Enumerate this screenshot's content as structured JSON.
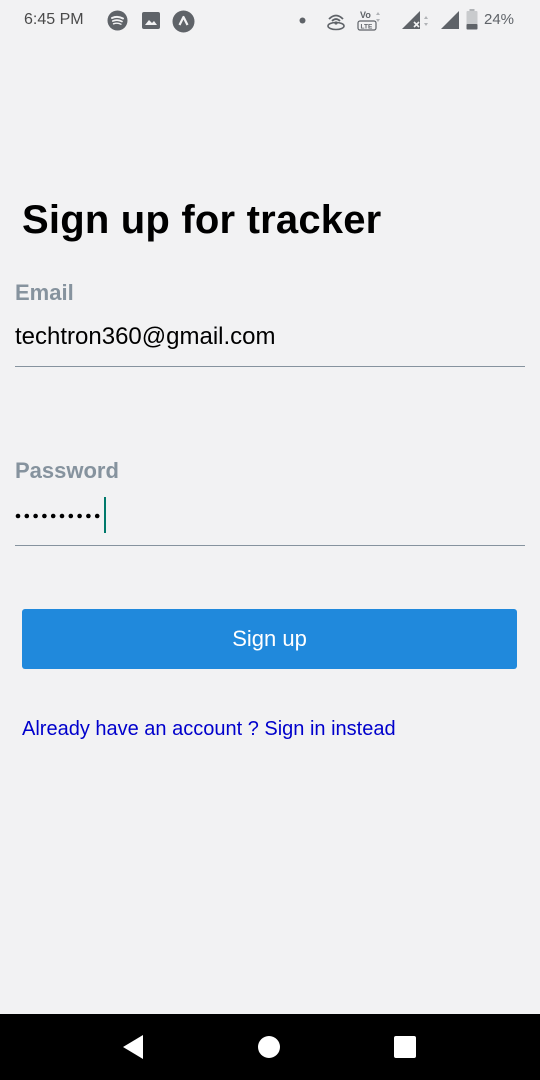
{
  "status_bar": {
    "time": "6:45 PM",
    "battery_percent": "24%",
    "left_icons": [
      "spotify-icon",
      "gallery-icon",
      "app-icon"
    ],
    "right_icons": [
      "dot-icon",
      "hotspot-icon",
      "volte-icon",
      "signal-icon",
      "signal-icon",
      "battery-icon"
    ]
  },
  "form": {
    "title": "Sign up for tracker",
    "email": {
      "label": "Email",
      "value": "techtron360@gmail.com"
    },
    "password": {
      "label": "Password",
      "masked_length": 10
    },
    "submit_label": "Sign up",
    "signin_link": "Already have an account ? Sign in instead"
  },
  "colors": {
    "background": "#f2f2f3",
    "button": "#2089dc",
    "label": "#86939e",
    "link": "#0000cc",
    "cursor": "#00796b"
  },
  "nav_bar": {
    "buttons": [
      "back-icon",
      "home-icon",
      "recents-icon"
    ]
  }
}
